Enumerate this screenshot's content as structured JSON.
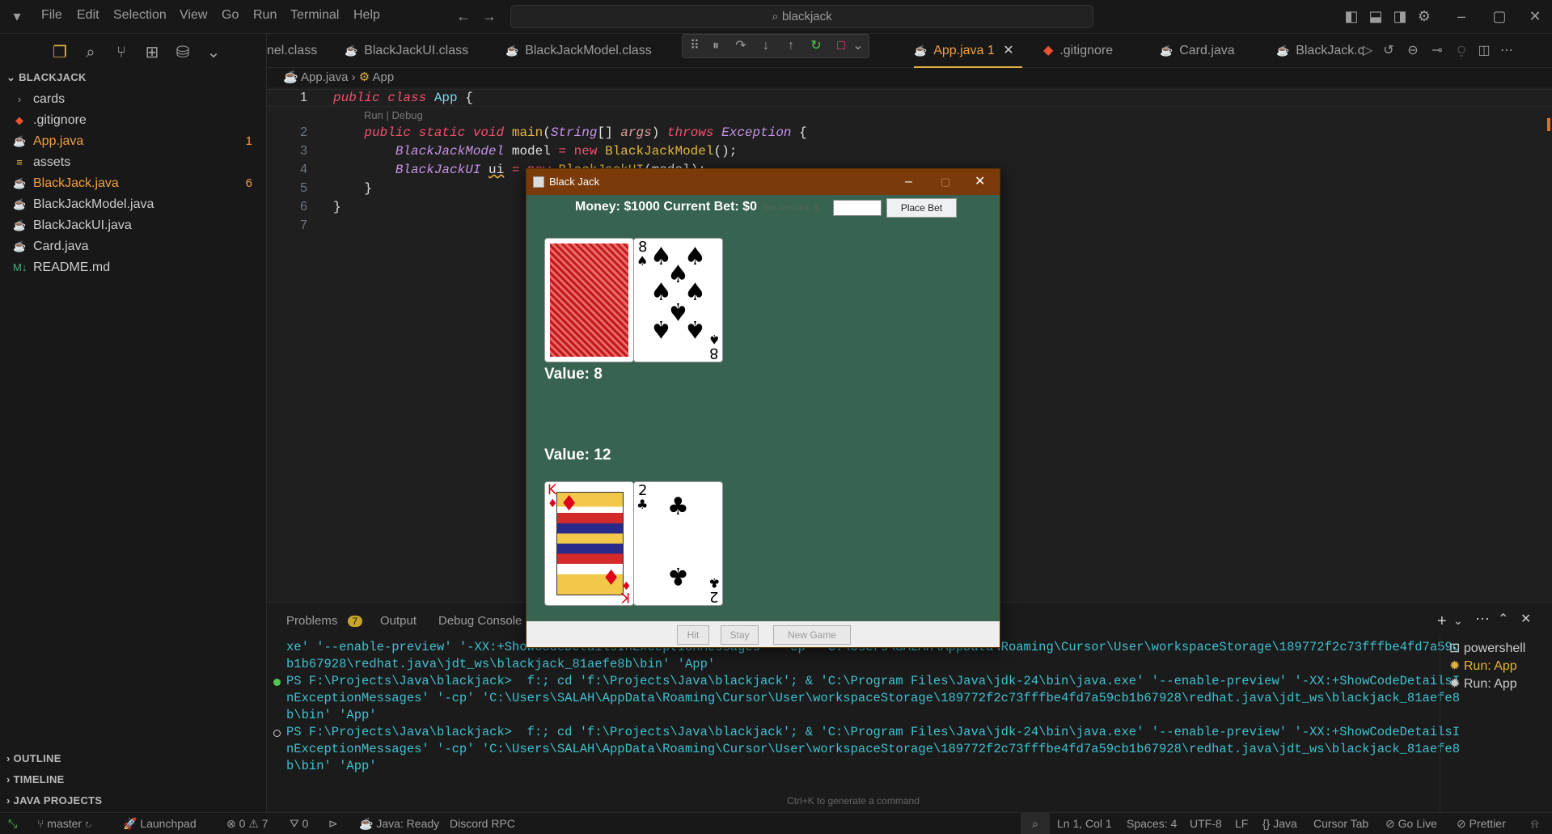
{
  "titlebar": {
    "menus": [
      "File",
      "Edit",
      "Selection",
      "View",
      "Go",
      "Run",
      "Terminal",
      "Help"
    ],
    "search_text": "blackjack"
  },
  "sidebar": {
    "title": "BLACKJACK",
    "items": [
      {
        "label": "cards",
        "icon": "chevron-right-icon",
        "badge": ""
      },
      {
        "label": ".gitignore",
        "icon": "git-icon",
        "badge": ""
      },
      {
        "label": "App.java",
        "icon": "java-icon",
        "badge": "1"
      },
      {
        "label": "assets",
        "icon": "file-icon",
        "badge": ""
      },
      {
        "label": "BlackJack.java",
        "icon": "java-icon",
        "badge": "6"
      },
      {
        "label": "BlackJackModel.java",
        "icon": "java-icon",
        "badge": ""
      },
      {
        "label": "BlackJackUI.java",
        "icon": "java-icon",
        "badge": ""
      },
      {
        "label": "Card.java",
        "icon": "java-icon",
        "badge": ""
      },
      {
        "label": "README.md",
        "icon": "markdown-icon",
        "badge": ""
      }
    ],
    "sections": [
      "OUTLINE",
      "TIMELINE",
      "JAVA PROJECTS"
    ]
  },
  "tabs": [
    {
      "label": "nel.class"
    },
    {
      "label": "BlackJackUI.class"
    },
    {
      "label": "BlackJackModel.class"
    },
    {
      "label": "App.java",
      "badge": "1"
    },
    {
      "label": ".gitignore"
    },
    {
      "label": "Card.java"
    },
    {
      "label": "BlackJack.c"
    }
  ],
  "breadcrumb": {
    "file": "App.java",
    "symbol": "App"
  },
  "editor": {
    "codelens": "Run | Debug",
    "line_numbers": [
      "1",
      "2",
      "3",
      "4",
      "5",
      "6",
      "7"
    ]
  },
  "panel": {
    "tabs": [
      "Problems",
      "Output",
      "Debug Console"
    ],
    "problems_count": "7",
    "terminal_lines": [
      "xe' '--enable-preview' '-XX:+ShowCodeDetailsInExceptionMessages' '-cp' 'C:\\Users\\SALAH\\AppData\\Roaming\\Cursor\\User\\workspaceStorage\\189772f2c73fffbe4fd7a59c",
      "b1b67928\\redhat.java\\jdt_ws\\blackjack_81aefe8b\\bin' 'App'",
      "PS F:\\Projects\\Java\\blackjack>  f:; cd 'f:\\Projects\\Java\\blackjack'; & 'C:\\Program Files\\Java\\jdk-24\\bin\\java.exe' '--enable-preview' '-XX:+ShowCodeDetailsI",
      "nExceptionMessages' '-cp' 'C:\\Users\\SALAH\\AppData\\Roaming\\Cursor\\User\\workspaceStorage\\189772f2c73fffbe4fd7a59cb1b67928\\redhat.java\\jdt_ws\\blackjack_81aefe8",
      "b\\bin' 'App'",
      "PS F:\\Projects\\Java\\blackjack>  f:; cd 'f:\\Projects\\Java\\blackjack'; & 'C:\\Program Files\\Java\\jdk-24\\bin\\java.exe' '--enable-preview' '-XX:+ShowCodeDetailsI",
      "nExceptionMessages' '-cp' 'C:\\Users\\SALAH\\AppData\\Roaming\\Cursor\\User\\workspaceStorage\\189772f2c73fffbe4fd7a59cb1b67928\\redhat.java\\jdt_ws\\blackjack_81aefe8",
      "b\\bin' 'App'"
    ],
    "terminals": [
      "powershell",
      "Run: App",
      "Run: App"
    ],
    "hint": "Ctrl+K to generate a command"
  },
  "statusbar": {
    "branch": "master",
    "launchpad": "Launchpad",
    "errors": "0",
    "warnings": "7",
    "ports": "0",
    "java": "Java: Ready",
    "discord": "Discord RPC",
    "position": "Ln 1, Col 1",
    "spaces": "Spaces: 4",
    "encoding": "UTF-8",
    "eol": "LF",
    "language": "Java",
    "tab": "Cursor Tab",
    "golive": "Go Live",
    "prettier": "Prettier"
  },
  "blackjack": {
    "title": "Black Jack",
    "money_text": "Money: $1000 Current Bet: $0",
    "bet_label": "Bet Amount: $",
    "bet_value": "",
    "place_bet": "Place Bet",
    "dealer_value": "Value: 8",
    "player_value": "Value: 12",
    "dealer_cards": [
      {
        "rank": "back",
        "suit": ""
      },
      {
        "rank": "8",
        "suit": "spades"
      }
    ],
    "player_cards": [
      {
        "rank": "K",
        "suit": "diamonds"
      },
      {
        "rank": "2",
        "suit": "clubs"
      }
    ],
    "buttons": {
      "hit": "Hit",
      "stay": "Stay",
      "new_game": "New Game"
    },
    "colors": {
      "table": "#376350",
      "titlebar": "#7a3a0a"
    }
  }
}
